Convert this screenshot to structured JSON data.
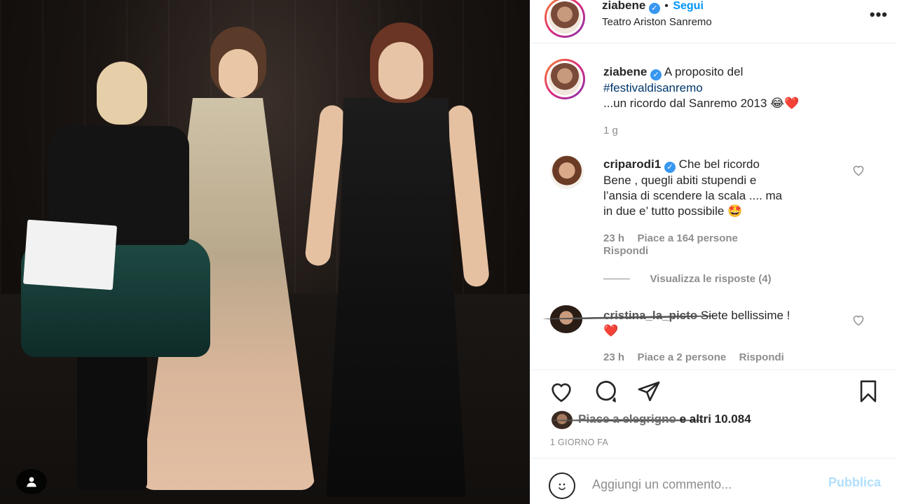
{
  "post": {
    "username": "ziabene",
    "follow_label": "Segui",
    "location": "Teatro Ariston Sanremo",
    "more_label": "•••"
  },
  "caption": {
    "username": "ziabene",
    "text_line1": "A proposito del",
    "hashtag": "#festivaldisanremo",
    "text_line3": "...un ricordo dal Sanremo 2013 😂❤️",
    "age": "1 g"
  },
  "comments": [
    {
      "username": "criparodi1",
      "text_line1": "Che bel ricordo",
      "text_line2": "Bene , quegli abiti stupendi e",
      "text_line3": "l’ansia di scendere la scala .... ma",
      "text_line4": "in due e’ tutto possibile 🤩",
      "age": "23 h",
      "likes": "Piace a 164 persone",
      "reply": "Rispondi",
      "view_replies": "Visualizza le risposte (4)"
    },
    {
      "username": "cristina_la_picto",
      "text": "Siete bellissime !",
      "emoji": "❤️",
      "age": "23 h",
      "likes": "Piace a 2 persone",
      "reply": "Rispondi"
    }
  ],
  "likes_line": {
    "prefix": "Piace a elegrigno",
    "suffix": "e altri 10.084"
  },
  "timestamp": "1 GIORNO FA",
  "comment_box": {
    "placeholder": "Aggiungi un commento...",
    "publish": "Pubblica"
  },
  "colors": {
    "accent": "#0095f6",
    "verified": "#3897f0",
    "muted": "#8e8e8e",
    "publish_disabled": "#b2dffc"
  },
  "icons": [
    "heart-icon",
    "comment-icon",
    "share-icon",
    "bookmark-icon",
    "emoji-icon",
    "more-icon",
    "verified-icon",
    "user-tag-icon"
  ]
}
